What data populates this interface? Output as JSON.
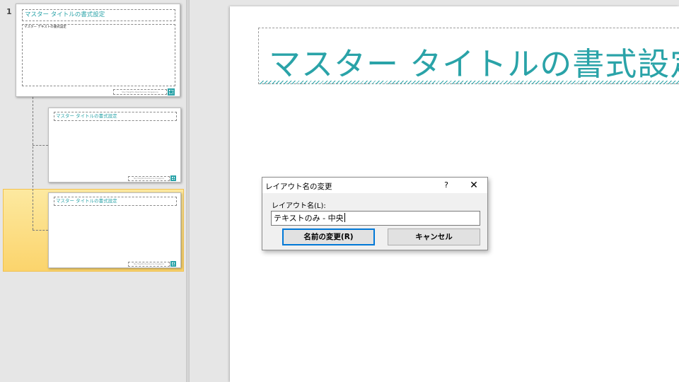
{
  "thumbnails": {
    "slide_number": "1",
    "master": {
      "title": "マスター タイトルの書式設定",
      "body": "マスター テキストの書式設定",
      "footer": "Sky Heights Residences Singapore"
    },
    "layout_1": {
      "title": "マスター タイトルの書式設定",
      "footer": "Sky Heights Residences Singapore"
    },
    "layout_2": {
      "title": "マスター タイトルの書式設定",
      "footer": "Sky Heights Residences Singapore",
      "selected": true
    }
  },
  "main_slide": {
    "title": "マスター タイトルの書式設定"
  },
  "rename_dialog": {
    "title": "レイアウト名の変更",
    "help_label": "?",
    "close_label": "✕",
    "field_label": "レイアウト名(L):",
    "field_value": "テキストのみ - 中央",
    "rename_button": "名前の変更(R)",
    "cancel_button": "キャンセル"
  },
  "colors": {
    "accent": "#2aa3a8",
    "selection": "#fbd46c",
    "default_button_border": "#0078d7"
  }
}
